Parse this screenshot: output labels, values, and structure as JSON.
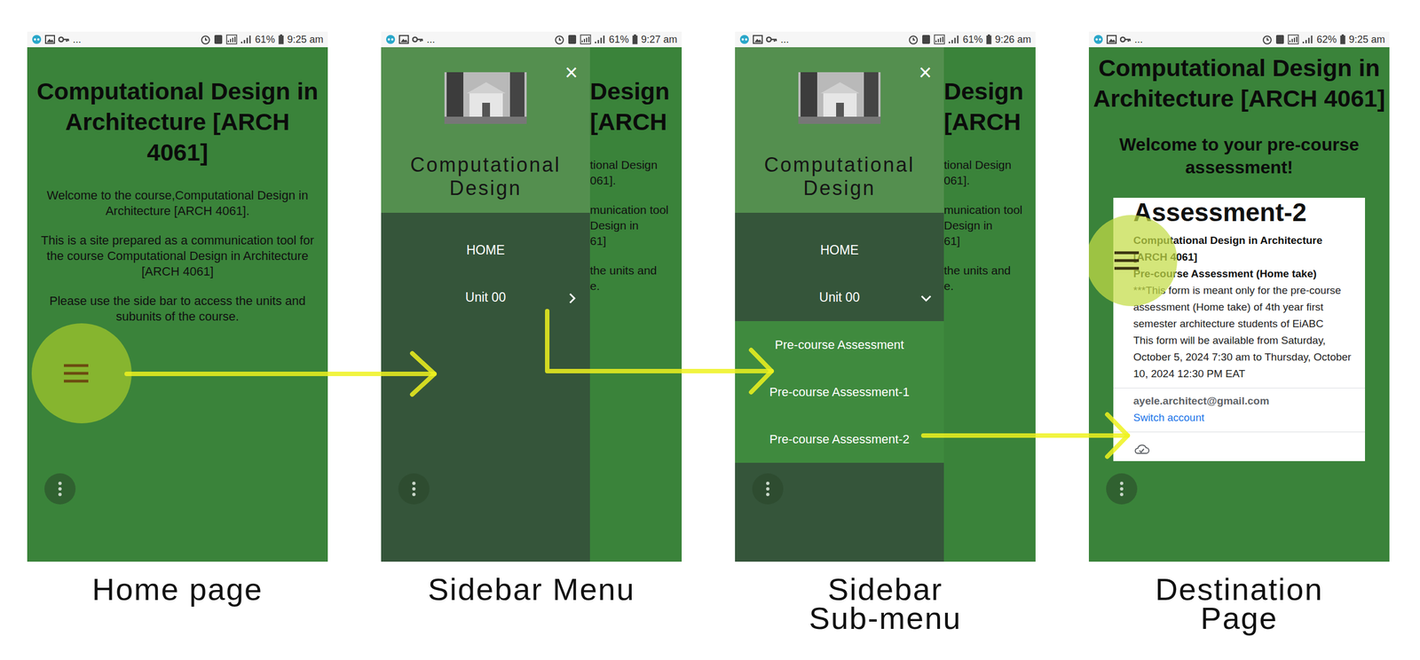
{
  "panels": [
    {
      "kind": "home",
      "caption": [
        "Home page"
      ],
      "status": {
        "more": "...",
        "battery": "61%",
        "time": "9:25 am"
      },
      "title": "Computational Design in Architecture [ARCH 4061]",
      "paragraphs": [
        "Welcome to the course,Computational Design in Architecture [ARCH 4061].",
        "This is a site prepared as a communication tool for the course Computational Design in Architecture [ARCH 4061]",
        "Please use the side bar to access the units and subunits of the course."
      ],
      "menu_highlighted": true
    },
    {
      "kind": "drawer",
      "caption": [
        "Sidebar Menu"
      ],
      "status": {
        "more": "...",
        "battery": "61%",
        "time": "9:27 am"
      },
      "behind": {
        "title_lines": [
          "Design",
          "[ARCH"
        ],
        "paragraph_lines": [
          [
            "tional Design",
            "061]."
          ],
          [
            "munication tool",
            "Design in",
            "61]"
          ],
          [
            "the units and",
            "e."
          ]
        ]
      },
      "drawer": {
        "close": "×",
        "title": "Computational Design",
        "items": [
          {
            "label": "HOME",
            "kind": "link"
          },
          {
            "label": "Unit 00",
            "kind": "group",
            "expanded": false,
            "children": []
          }
        ]
      }
    },
    {
      "kind": "drawer",
      "caption": [
        "Sidebar",
        "Sub-menu"
      ],
      "status": {
        "more": "...",
        "battery": "61%",
        "time": "9:26 am"
      },
      "behind": {
        "title_lines": [
          "Design",
          "[ARCH"
        ],
        "paragraph_lines": [
          [
            "tional Design",
            "061]."
          ],
          [
            "munication tool",
            "Design in",
            "61]"
          ],
          [
            "the units and",
            "e."
          ]
        ]
      },
      "drawer": {
        "close": "×",
        "title": "Computational Design",
        "items": [
          {
            "label": "HOME",
            "kind": "link"
          },
          {
            "label": "Unit 00",
            "kind": "group",
            "expanded": true,
            "children": [
              "Pre-course Assessment",
              "Pre-course Assessment-1",
              "Pre-course Assessment-2"
            ]
          }
        ]
      }
    },
    {
      "kind": "page",
      "caption": [
        "Destination",
        "Page"
      ],
      "status": {
        "more": "...",
        "battery": "62%",
        "time": "9:25 am"
      },
      "title": "Computational Design in Architecture [ARCH 4061]",
      "subtitle": "Welcome to your pre-course assessment!",
      "form": {
        "title": "Assessment-2",
        "bold_lines": [
          "Computational Design in Architecture [ARCH 4061]",
          "Pre-course Assessment (Home take)"
        ],
        "lines": [
          "***This form is meant only for the pre-course assessment (Home take) of 4th year first semester architecture students of EiABC",
          "This form will be available from Saturday, October 5, 2024 7:30 am to Thursday, October 10, 2024 12:30 PM EAT"
        ],
        "email": "ayele.architect@gmail.com",
        "switch": "Switch account"
      },
      "menu_highlighted": true
    }
  ]
}
